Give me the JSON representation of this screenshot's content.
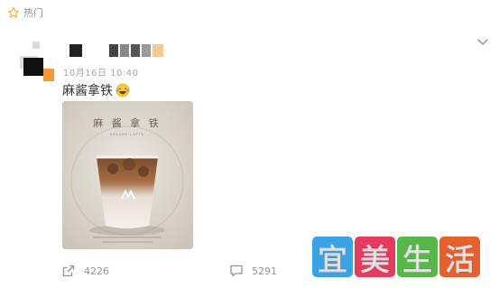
{
  "feed": {
    "hot_tag": {
      "label": "热门",
      "icon": "star-outline-icon"
    }
  },
  "post": {
    "time": "10月16日 10:40",
    "text": "麻酱拿铁",
    "emoji": "laughing-tears-emoji",
    "image": {
      "title": "麻 酱 拿 铁",
      "subtitle": "SESAME LATTE"
    },
    "menu_icon": "chevron-down-icon"
  },
  "actions": {
    "repost": {
      "icon": "share-icon",
      "count": "4226"
    },
    "comment": {
      "icon": "comment-icon",
      "count": "5291"
    }
  },
  "watermark": {
    "chars": [
      "宜",
      "美",
      "生",
      "活"
    ],
    "colors": [
      "#3aa3e8",
      "#e83a5f",
      "#56b848",
      "#e85f2a"
    ]
  }
}
